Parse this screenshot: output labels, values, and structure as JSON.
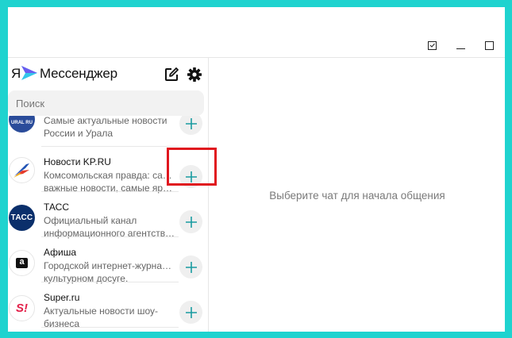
{
  "app": {
    "logo_ya": "Я",
    "logo_text": "Мессенджер"
  },
  "search": {
    "placeholder": "Поиск"
  },
  "chats": [
    {
      "name": "",
      "desc": [
        "Самые актуальные новости",
        "России и Урала"
      ],
      "avatar_icon": "ural-news-logo",
      "avatar_text": "URAL RU"
    },
    {
      "name": "Новости KP.RU",
      "desc": [
        "Комсомольская правда: самые",
        "важные новости, самые ярк..."
      ],
      "avatar_icon": "kp-bird-logo"
    },
    {
      "name": "ТАСС",
      "desc": [
        "Официальный канал",
        "информационного агентства..."
      ],
      "avatar_icon": "tass-logo",
      "avatar_text": "ТАСС"
    },
    {
      "name": "Афиша",
      "desc": [
        "Городской интернет-журнал о",
        "культурном досуге."
      ],
      "avatar_icon": "afisha-logo",
      "avatar_text": "a"
    },
    {
      "name": "Super.ru",
      "desc": [
        "Актуальные новости шоу-",
        "бизнеса"
      ],
      "avatar_icon": "super-logo",
      "avatar_text": "S!"
    }
  ],
  "main": {
    "empty_text": "Выберите чат для начала общения"
  },
  "colors": {
    "frame": "#1fd3cf",
    "accent": "#1a9ba0",
    "highlight": "#e0161e",
    "tass": "#0b2f6b",
    "ural": "#2a4c9a",
    "super": "#e3204a"
  }
}
